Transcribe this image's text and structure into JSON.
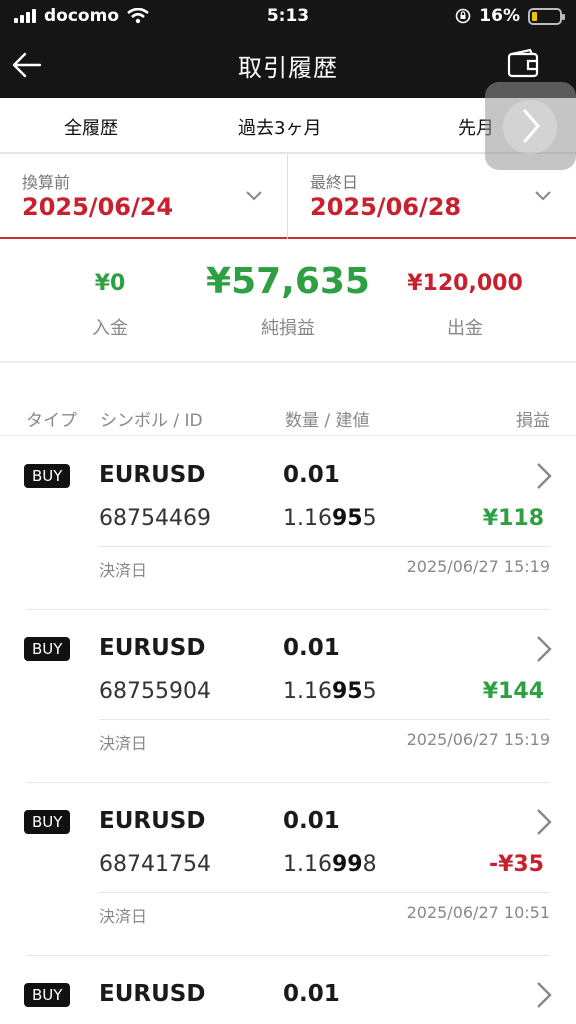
{
  "status": {
    "carrier": "docomo",
    "time": "5:13",
    "battery": "16%"
  },
  "nav": {
    "title": "取引履歴"
  },
  "tabs": [
    {
      "label": "全履歴"
    },
    {
      "label": "過去3ヶ月"
    },
    {
      "label": "先月"
    }
  ],
  "filters": {
    "from_label": "換算前",
    "from_value": "2025/06/24",
    "to_label": "最終日",
    "to_value": "2025/06/28"
  },
  "summary": {
    "deposit": {
      "amount": "¥0",
      "label": "入金"
    },
    "net": {
      "amount": "¥57,635",
      "label": "純損益"
    },
    "withdraw": {
      "amount": "¥120,000",
      "label": "出金"
    }
  },
  "columns": {
    "type": "タイプ",
    "symbol": "シンボル / ID",
    "qty": "数量 / 建値",
    "pnl": "損益"
  },
  "colors": {
    "accent_red": "#c8202d",
    "profit_green": "#2ea043",
    "header_bg": "#151515"
  },
  "trades": [
    {
      "type": "BUY",
      "symbol": "EURUSD",
      "qty": "0.01",
      "id": "68754469",
      "price_pre": "1.16",
      "price_bold": "95",
      "price_post": "5",
      "pnl": "¥118",
      "settle_label": "決済日",
      "settle_time": "2025/06/27 15:19"
    },
    {
      "type": "BUY",
      "symbol": "EURUSD",
      "qty": "0.01",
      "id": "68755904",
      "price_pre": "1.16",
      "price_bold": "95",
      "price_post": "5",
      "pnl": "¥144",
      "settle_label": "決済日",
      "settle_time": "2025/06/27 15:19"
    },
    {
      "type": "BUY",
      "symbol": "EURUSD",
      "qty": "0.01",
      "id": "68741754",
      "price_pre": "1.16",
      "price_bold": "99",
      "price_post": "8",
      "pnl": "-¥35",
      "settle_label": "決済日",
      "settle_time": "2025/06/27 10:51"
    },
    {
      "type": "BUY",
      "symbol": "EURUSD",
      "qty": "0.01"
    }
  ]
}
